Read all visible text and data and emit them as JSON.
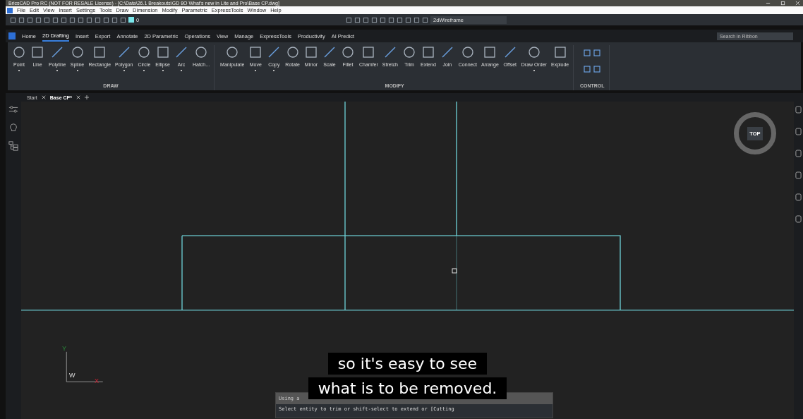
{
  "window": {
    "title": "BricsCAD Pro RC (NOT FOR RESALE License) - [C:\\Data\\26.1 Breakouts\\GD 8O What's new in Lite and Pro\\Base CP.dwg]"
  },
  "menu": [
    "File",
    "Edit",
    "View",
    "Insert",
    "Settings",
    "Tools",
    "Draw",
    "Dimension",
    "Modify",
    "Parametric",
    "ExpressTools",
    "Window",
    "Help"
  ],
  "toolbar": {
    "layer": "0",
    "visual_style": "2dWireframe"
  },
  "ribbon_tabs": [
    {
      "label": "Home",
      "selected": false
    },
    {
      "label": "2D Drafting",
      "selected": true
    },
    {
      "label": "Insert",
      "selected": false
    },
    {
      "label": "Export",
      "selected": false
    },
    {
      "label": "Annotate",
      "selected": false
    },
    {
      "label": "2D Parametric",
      "selected": false
    },
    {
      "label": "Operations",
      "selected": false
    },
    {
      "label": "View",
      "selected": false
    },
    {
      "label": "Manage",
      "selected": false
    },
    {
      "label": "ExpressTools",
      "selected": false
    },
    {
      "label": "Productivity",
      "selected": false
    },
    {
      "label": "AI Predict",
      "selected": false
    }
  ],
  "ribbon_search": {
    "placeholder": "Search in Ribbon"
  },
  "ribbon_groups": [
    {
      "title": "DRAW",
      "tools": [
        {
          "label": "Point",
          "dropdown": true
        },
        {
          "label": "Line",
          "dropdown": false
        },
        {
          "label": "Polyline",
          "dropdown": true
        },
        {
          "label": "Spline",
          "dropdown": true
        },
        {
          "label": "Rectangle",
          "dropdown": false
        },
        {
          "label": "Polygon",
          "dropdown": true
        },
        {
          "label": "Circle",
          "dropdown": true
        },
        {
          "label": "Ellipse",
          "dropdown": true
        },
        {
          "label": "Arc",
          "dropdown": true
        },
        {
          "label": "Hatch...",
          "dropdown": false
        }
      ]
    },
    {
      "title": "MODIFY",
      "tools": [
        {
          "label": "Manipulate",
          "dropdown": false
        },
        {
          "label": "Move",
          "dropdown": true
        },
        {
          "label": "Copy",
          "dropdown": true
        },
        {
          "label": "Rotate",
          "dropdown": false
        },
        {
          "label": "Mirror",
          "dropdown": false
        },
        {
          "label": "Scale",
          "dropdown": false
        },
        {
          "label": "Fillet",
          "dropdown": false
        },
        {
          "label": "Chamfer",
          "dropdown": false
        },
        {
          "label": "Stretch",
          "dropdown": false
        },
        {
          "label": "Trim",
          "dropdown": false
        },
        {
          "label": "Extend",
          "dropdown": false
        },
        {
          "label": "Join",
          "dropdown": false
        },
        {
          "label": "Connect",
          "dropdown": false
        },
        {
          "label": "Arrange",
          "dropdown": false
        },
        {
          "label": "Offset",
          "dropdown": false
        },
        {
          "label": "Draw Order",
          "dropdown": true
        },
        {
          "label": "Explode",
          "dropdown": false
        }
      ]
    },
    {
      "title": "CONTROL"
    }
  ],
  "doc_tabs": [
    {
      "label": "Start",
      "selected": false
    },
    {
      "label": "Base CP*",
      "selected": true
    }
  ],
  "viewcube": {
    "label": "TOP"
  },
  "ucs": {
    "y": "Y",
    "x": "X",
    "w": "W"
  },
  "command_line": {
    "history": "Using a",
    "prompt": "Select entity to trim or shift-select to extend or [Cutting"
  },
  "captions": [
    "so it's easy to see",
    "what is to be removed."
  ]
}
